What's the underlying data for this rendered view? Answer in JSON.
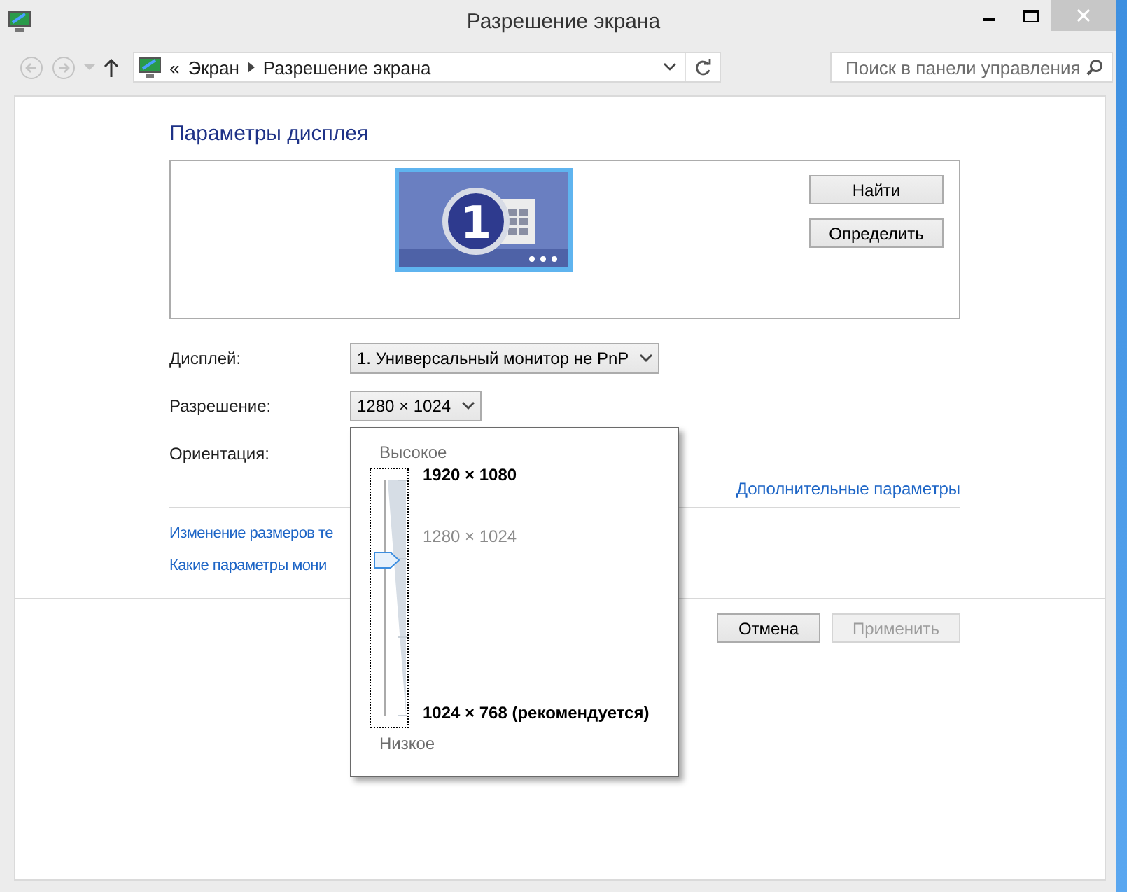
{
  "window": {
    "title": "Разрешение экрана"
  },
  "address_bar": {
    "prefix": "«",
    "crumbs": [
      "Экран",
      "Разрешение экрана"
    ]
  },
  "search": {
    "placeholder": "Поиск в панели управления"
  },
  "heading": "Параметры дисплея",
  "display_buttons": [
    {
      "label": "Найти"
    },
    {
      "label": "Определить"
    }
  ],
  "monitor_number": "1",
  "fields": [
    {
      "label": "Дисплей:",
      "value": "1. Универсальный монитор не PnP"
    },
    {
      "label": "Разрешение:",
      "value": "1280 × 1024"
    },
    {
      "label": "Ориентация:"
    }
  ],
  "advanced_link": "Дополнительные параметры",
  "links": [
    "Изменение размеров те",
    "Какие параметры мони"
  ],
  "buttons": [
    {
      "label": "Отмена",
      "disabled": false
    },
    {
      "label": "Применить",
      "disabled": true
    }
  ],
  "resolution_popup": {
    "high": "Высокое",
    "low": "Низкое",
    "level": 0.66,
    "options": [
      {
        "label": "1920 × 1080",
        "selected": false
      },
      {
        "label": "1280 × 1024",
        "selected": true
      },
      {
        "label": "1024 × 768 (рекомендуется)",
        "selected": false
      }
    ]
  }
}
